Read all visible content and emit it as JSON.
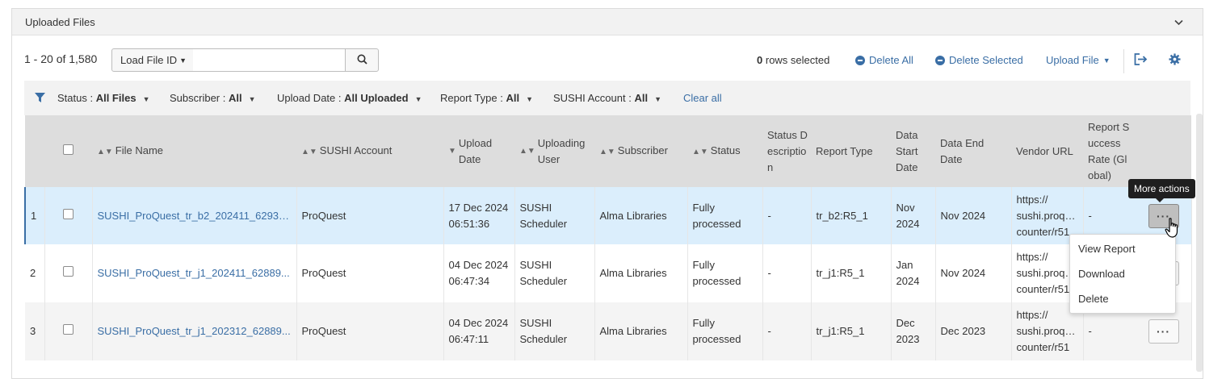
{
  "section": {
    "title": "Uploaded Files"
  },
  "toolbar": {
    "range": "1 - 20 of 1,580",
    "load_file_label": "Load File ID",
    "search_value": "",
    "rows_selected_count": "0",
    "rows_selected_label": "rows selected",
    "delete_all": "Delete All",
    "delete_selected": "Delete Selected",
    "upload_file": "Upload File"
  },
  "filters": {
    "status": {
      "label": "Status :",
      "value": "All Files"
    },
    "subscriber": {
      "label": "Subscriber :",
      "value": "All"
    },
    "upload_date": {
      "label": "Upload Date :",
      "value": "All Uploaded"
    },
    "report_type": {
      "label": "Report Type :",
      "value": "All"
    },
    "sushi_account": {
      "label": "SUSHI Account :",
      "value": "All"
    },
    "clear_all": "Clear all"
  },
  "columns": {
    "file_name": "File Name",
    "sushi_account": "SUSHI Account",
    "upload_date": "Upload Date",
    "uploading_user": "Uploading User",
    "subscriber": "Subscriber",
    "status": "Status",
    "status_description": "Status Description",
    "report_type": "Report Type",
    "data_start_date": "Data Start Date",
    "data_end_date": "Data End Date",
    "vendor_url": "Vendor URL",
    "report_success_rate": "Report Success Rate (Global)"
  },
  "rows": [
    {
      "num": "1",
      "file_name": "SUSHI_ProQuest_tr_b2_202411_62930...",
      "sushi_account": "ProQuest",
      "upload_date": "17 Dec 2024 06:51:36",
      "uploading_user": "SUSHI Scheduler",
      "subscriber": "Alma Libraries",
      "status": "Fully processed",
      "status_description": "-",
      "report_type": "tr_b2:R5_1",
      "data_start_date": "Nov 2024",
      "data_end_date": "Nov 2024",
      "vendor_url": "https:// sushi.proqu... counter/r51",
      "success_rate": "-"
    },
    {
      "num": "2",
      "file_name": "SUSHI_ProQuest_tr_j1_202411_62889...",
      "sushi_account": "ProQuest",
      "upload_date": "04 Dec 2024 06:47:34",
      "uploading_user": "SUSHI Scheduler",
      "subscriber": "Alma Libraries",
      "status": "Fully processed",
      "status_description": "-",
      "report_type": "tr_j1:R5_1",
      "data_start_date": "Jan 2024",
      "data_end_date": "Nov 2024",
      "vendor_url": "https:// sushi.proqu... counter/r51",
      "success_rate": "-"
    },
    {
      "num": "3",
      "file_name": "SUSHI_ProQuest_tr_j1_202312_62889...",
      "sushi_account": "ProQuest",
      "upload_date": "04 Dec 2024 06:47:11",
      "uploading_user": "SUSHI Scheduler",
      "subscriber": "Alma Libraries",
      "status": "Fully processed",
      "status_description": "-",
      "report_type": "tr_j1:R5_1",
      "data_start_date": "Dec 2023",
      "data_end_date": "Dec 2023",
      "vendor_url": "https:// sushi.proqu... counter/r51",
      "success_rate": "-"
    }
  ],
  "tooltip": "More actions",
  "more_actions_menu": [
    "View Report",
    "Download",
    "Delete"
  ],
  "colors": {
    "link": "#3a6ea5",
    "selected_row": "#dbeefc",
    "header_bg": "#dddddd",
    "filter_bg": "#f2f2f2"
  }
}
